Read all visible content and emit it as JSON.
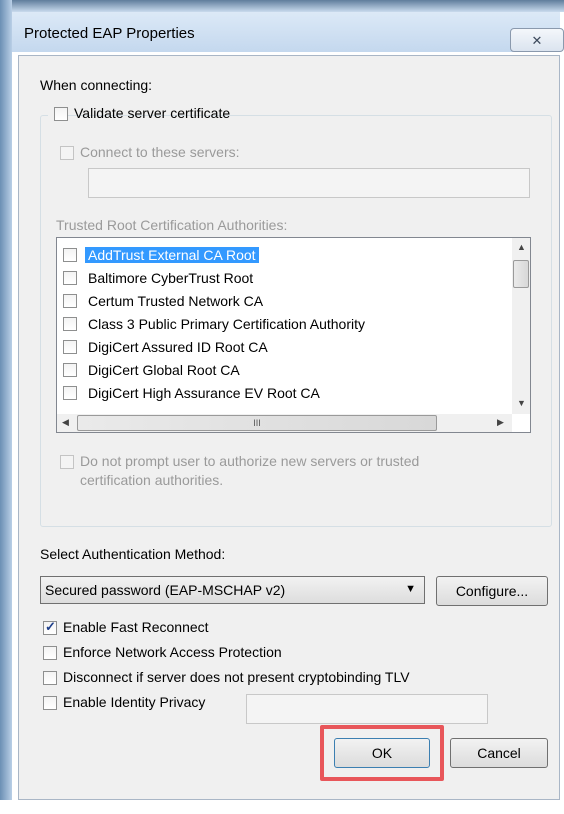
{
  "window": {
    "title": "Protected EAP Properties",
    "close_glyph": "✕"
  },
  "when_connecting": {
    "label": "When connecting:",
    "validate_cert": {
      "label": "Validate server certificate",
      "checked": false
    },
    "connect_servers": {
      "label": "Connect to these servers:",
      "checked": false,
      "value": ""
    },
    "trusted_root_label": "Trusted Root Certification Authorities:",
    "authorities": [
      {
        "label": "AddTrust External CA Root",
        "checked": false,
        "selected": true
      },
      {
        "label": "Baltimore CyberTrust Root",
        "checked": false
      },
      {
        "label": "Certum Trusted Network CA",
        "checked": false
      },
      {
        "label": "Class 3 Public Primary Certification Authority",
        "checked": false
      },
      {
        "label": "DigiCert Assured ID Root CA",
        "checked": false
      },
      {
        "label": "DigiCert Global Root CA",
        "checked": false
      },
      {
        "label": "DigiCert High Assurance EV Root CA",
        "checked": false
      }
    ],
    "hscroll_grip": "III",
    "no_prompt": {
      "line1": "Do not prompt user to authorize new servers or trusted",
      "line2": "certification authorities.",
      "checked": false
    }
  },
  "auth": {
    "label": "Select Authentication Method:",
    "method": "Secured password (EAP-MSCHAP v2)",
    "configure_label": "Configure..."
  },
  "options": {
    "fast_reconnect": {
      "label": "Enable Fast Reconnect",
      "checked": true
    },
    "nap": {
      "label": "Enforce Network Access Protection",
      "checked": false
    },
    "cryptobinding": {
      "label": "Disconnect if server does not present cryptobinding TLV",
      "checked": false
    },
    "identity_privacy": {
      "label": "Enable Identity Privacy",
      "checked": false,
      "value": ""
    }
  },
  "footer": {
    "ok_label": "OK",
    "cancel_label": "Cancel"
  },
  "colors": {
    "selection": "#3399ff",
    "highlight_box": "#e8565a"
  }
}
